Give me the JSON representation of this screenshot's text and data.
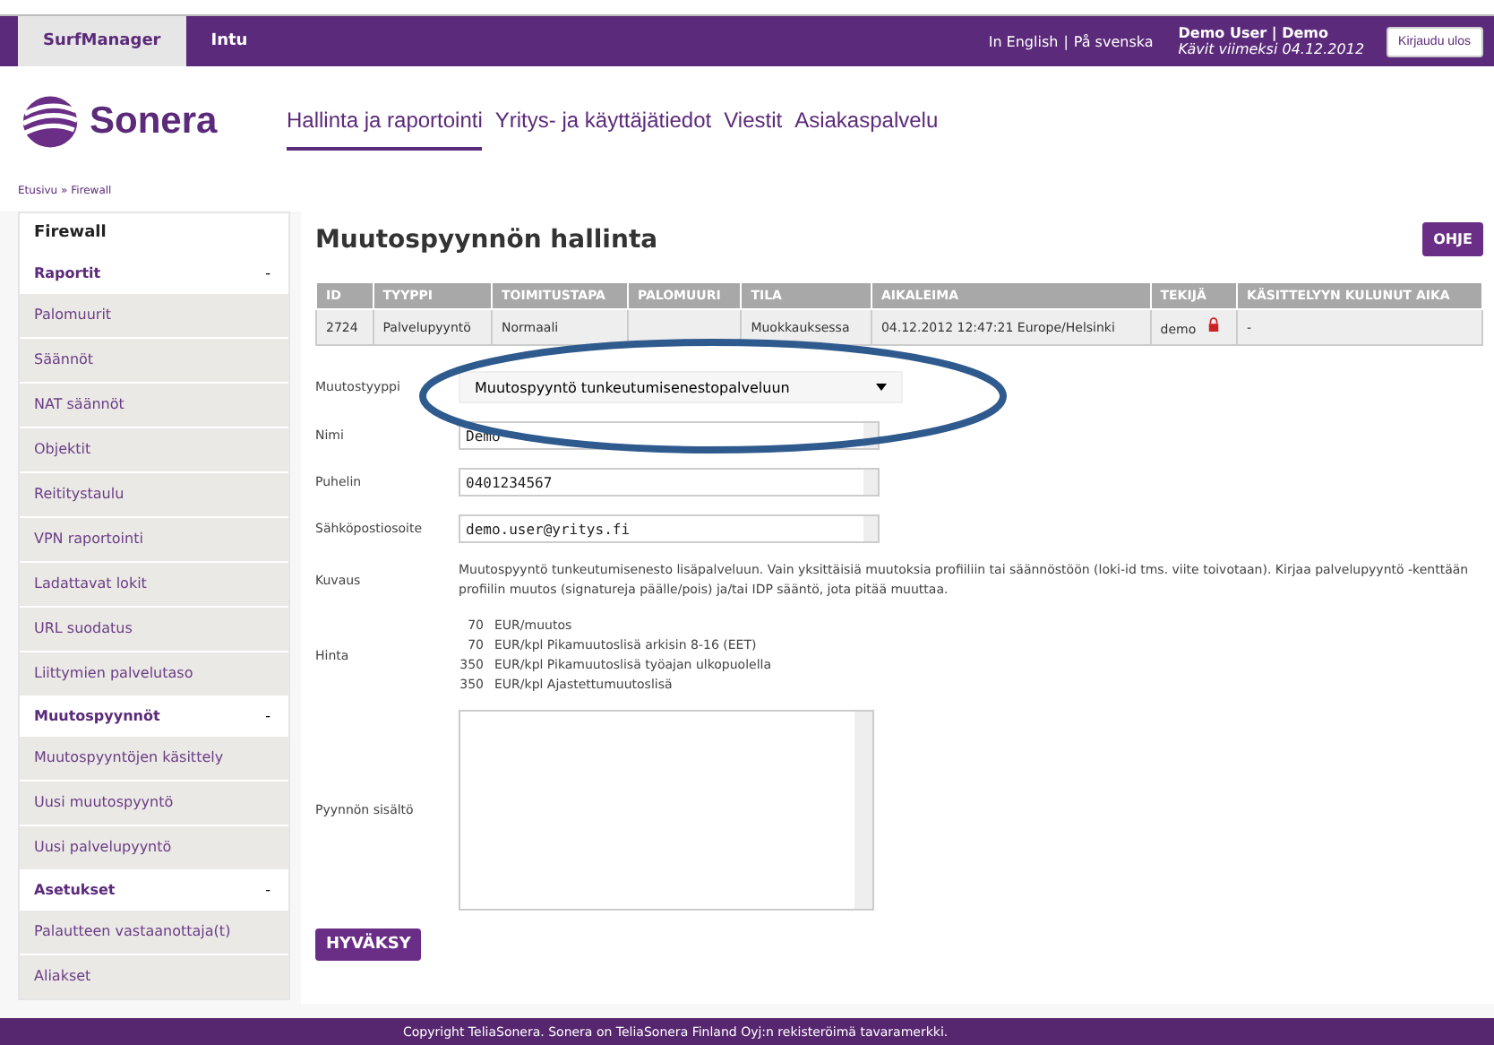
{
  "topbar": {
    "tabs": [
      {
        "label": "SurfManager",
        "selected": true
      },
      {
        "label": "Intu",
        "selected": false
      }
    ],
    "languages": [
      "In English",
      "På svenska"
    ],
    "separator": "|",
    "user": "Demo User | Demo",
    "last_visit": "Kävit viimeksi 04.12.2012",
    "logout": "Kirjaudu ulos"
  },
  "header": {
    "logo": "Sonera",
    "nav": [
      {
        "label": "Hallinta ja raportointi",
        "selected": true
      },
      {
        "label": "Yritys- ja käyttäjätiedot",
        "selected": false
      },
      {
        "label": "Viestit",
        "selected": false
      },
      {
        "label": "Asiakaspalvelu",
        "selected": false
      }
    ]
  },
  "breadcrumb": "Etusivu » Firewall",
  "sidebar": {
    "title": "Firewall",
    "groups": [
      {
        "label": "Raportit",
        "toggle": "-",
        "items": [
          "Palomuurit",
          "Säännöt",
          "NAT säännöt",
          "Objektit",
          "Reititystaulu",
          "VPN raportointi",
          "Ladattavat lokit",
          "URL suodatus",
          "Liittymien palvelutaso"
        ]
      },
      {
        "label": "Muutospyynnöt",
        "toggle": "-",
        "items": [
          "Muutospyyntöjen käsittely",
          "Uusi muutospyyntö",
          "Uusi palvelupyyntö"
        ]
      },
      {
        "label": "Asetukset",
        "toggle": "-",
        "items": [
          "Palautteen vastaanottaja(t)",
          "Aliakset"
        ]
      }
    ]
  },
  "page": {
    "title": "Muutospyynnön hallinta",
    "help_button": "OHJE",
    "table": {
      "columns": [
        "ID",
        "TYYPPI",
        "TOIMITUSTAPA",
        "PALOMUURI",
        "TILA",
        "AIKALEIMA",
        "TEKIJÄ",
        "KÄSITTELYYN KULUNUT AIKA"
      ],
      "rows": [
        {
          "cells": [
            "2724",
            "Palvelupyyntö",
            "Normaali",
            "",
            "Muokkauksessa",
            "04.12.2012 12:47:21 Europe/Helsinki",
            "demo",
            "-"
          ],
          "locked": true
        }
      ]
    },
    "form": {
      "type_label": "Muutostyyppi",
      "type_value": "Muutospyyntö tunkeutumisenestopalveluun",
      "fields": [
        {
          "label": "Nimi",
          "value": "Demo"
        },
        {
          "label": "Puhelin",
          "value": "0401234567"
        },
        {
          "label": "Sähköpostiosoite",
          "value": "demo.user@yritys.fi"
        }
      ],
      "description_label": "Kuvaus",
      "description": "Muutospyyntö tunkeutumisenesto lisäpalveluun. Vain yksittäisiä muutoksia profiiliin tai säännöstöön (loki-id tms. viite toivotaan). Kirjaa palvelupyyntö -kenttään profiilin muutos (signatureja päälle/pois) ja/tai IDP sääntö, jota pitää muuttaa.",
      "price_label": "Hinta",
      "prices": [
        {
          "amount": "70",
          "text": "EUR/muutos"
        },
        {
          "amount": "70",
          "text": "EUR/kpl Pikamuutoslisä arkisin 8-16 (EET)"
        },
        {
          "amount": "350",
          "text": "EUR/kpl Pikamuutoslisä työajan ulkopuolella"
        },
        {
          "amount": "350",
          "text": "EUR/kpl Ajastettumuutoslisä"
        }
      ],
      "content_label": "Pyynnön sisältö",
      "submit": "HYVÄKSY"
    }
  },
  "footer": "Copyright TeliaSonera. Sonera on TeliaSonera Finland Oyj:n rekisteröimä tavaramerkki."
}
